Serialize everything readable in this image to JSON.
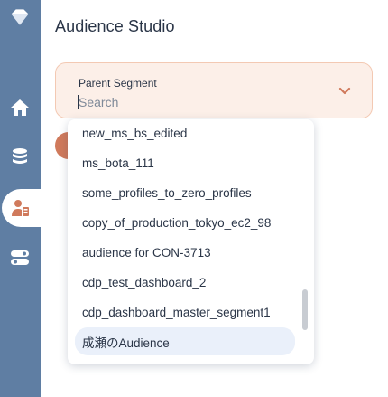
{
  "sidebar": {
    "logo_icon": "diamond-icon",
    "items": [
      {
        "name": "home",
        "icon": "home-icon"
      },
      {
        "name": "data-workbench",
        "icon": "database-icon"
      },
      {
        "name": "audience-studio",
        "icon": "audience-icon",
        "active": true
      },
      {
        "name": "settings",
        "icon": "toggle-settings-icon"
      }
    ]
  },
  "header": {
    "title": "Audience Studio"
  },
  "parent_segment": {
    "label": "Parent Segment",
    "placeholder": "Search",
    "value": ""
  },
  "dropdown": {
    "options": [
      "new_ms_bs_edited",
      "ms_bota_111",
      "some_profiles_to_zero_profiles",
      "copy_of_production_tokyo_ec2_98",
      "audience for CON-3713",
      "cdp_test_dashboard_2",
      "cdp_dashboard_master_segment1",
      "成瀬のAudience"
    ],
    "selected_index": 7
  },
  "colors": {
    "sidebar": "#5f7ea3",
    "field_bg": "#fcefe8",
    "field_border": "#f3c9b3",
    "accent": "#d07a5c",
    "text": "#2a3547",
    "selected_option": "#eaf0fa"
  }
}
